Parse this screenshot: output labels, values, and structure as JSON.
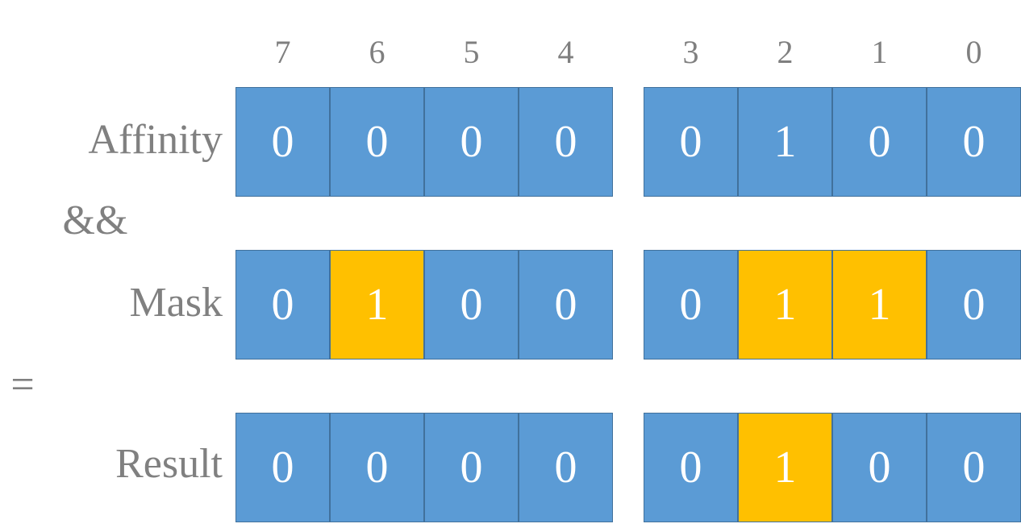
{
  "diagram": {
    "title": "Affinity && Mask = Result",
    "bit_headers": [
      "7",
      "6",
      "5",
      "4",
      "3",
      "2",
      "1",
      "0"
    ],
    "colors": {
      "bit_clear": "#5B9BD5",
      "bit_set": "#FFC000",
      "cell_border": "#41719C",
      "text_on_cell": "#FFFFFF",
      "label_text": "#808080",
      "header_text": "#7F7F7F",
      "background": "#FFFFFF"
    },
    "operators": {
      "and": "&&",
      "equals": "="
    },
    "rows": [
      {
        "label": "Affinity",
        "bits": [
          "0",
          "0",
          "0",
          "0",
          "0",
          "1",
          "0",
          "0"
        ],
        "set": [
          false,
          false,
          false,
          false,
          false,
          true,
          false,
          false
        ]
      },
      {
        "label": "Mask",
        "bits": [
          "0",
          "1",
          "0",
          "0",
          "0",
          "1",
          "1",
          "0"
        ],
        "set": [
          false,
          true,
          false,
          false,
          false,
          true,
          true,
          false
        ]
      },
      {
        "label": "Result",
        "bits": [
          "0",
          "0",
          "0",
          "0",
          "0",
          "1",
          "0",
          "0"
        ],
        "set": [
          false,
          false,
          false,
          false,
          false,
          true,
          false,
          false
        ]
      }
    ]
  }
}
